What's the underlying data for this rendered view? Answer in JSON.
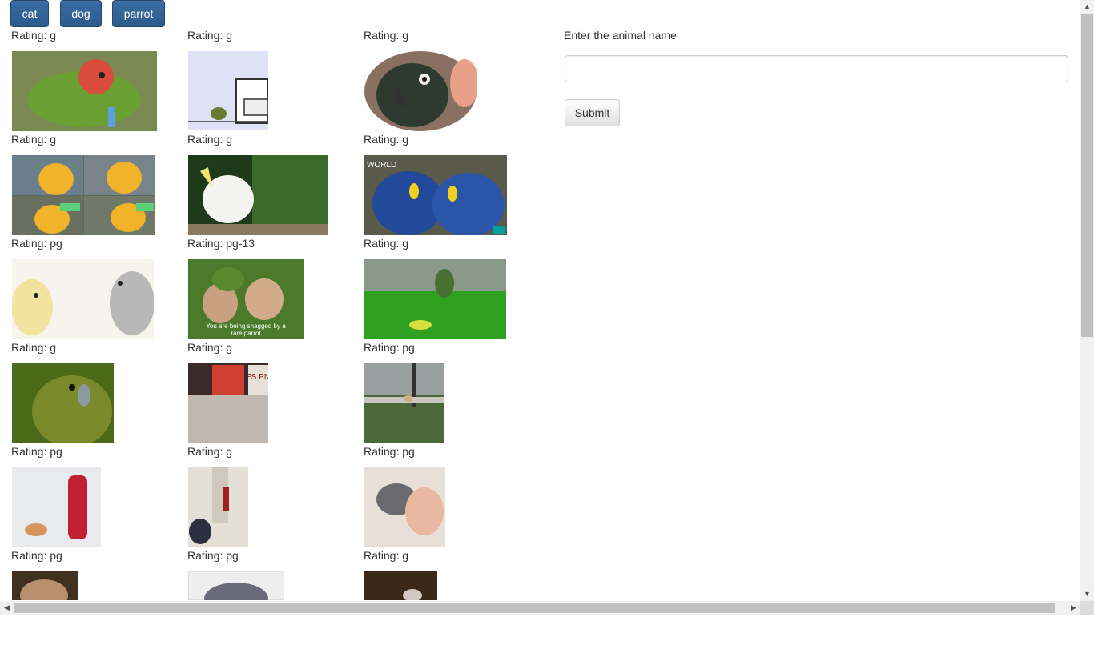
{
  "nav": {
    "buttons": [
      "cat",
      "dog",
      "parrot"
    ]
  },
  "form": {
    "label": "Enter the animal name",
    "input_value": "",
    "submit_label": "Submit"
  },
  "ratings": [
    [
      "Rating: g",
      "Rating: g",
      "Rating: g"
    ],
    [
      "Rating: g",
      "Rating: g",
      "Rating: g"
    ],
    [
      "Rating: pg",
      "Rating: pg-13",
      "Rating: g"
    ],
    [
      "Rating: g",
      "Rating: g",
      "Rating: pg"
    ],
    [
      "Rating: pg",
      "Rating: g",
      "Rating: pg"
    ],
    [
      "Rating: pg",
      "Rating: pg",
      "Rating: g"
    ]
  ],
  "gif_texts": {
    "world_badge": "WORLD",
    "caption_line1": "You are being shagged by a",
    "caption_line2": "rare parrot",
    "espn": "ES PN"
  },
  "colors": {
    "nav_button": "#2d5a8a",
    "text": "#333333",
    "scroll_thumb": "#c1c1c1"
  }
}
